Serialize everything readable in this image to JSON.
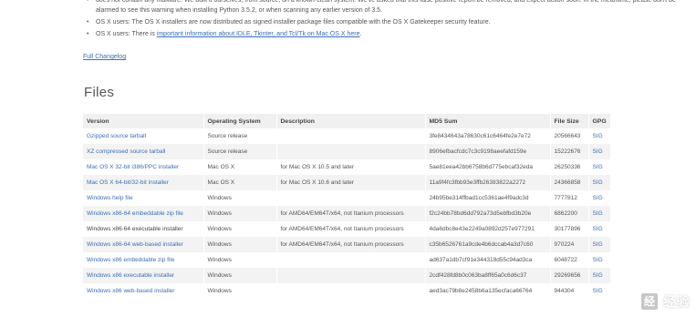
{
  "notes": [
    {
      "text_a": "does not contain any malware. We built it ourselves, from source, on a known-clean system. We've asked that this false positive report be removed, and expect action soon. In the meantime, please don't be alarmed to see this warning when installing Python 3.5.2, or when scanning any earlier version of 3.5.",
      "link": "",
      "text_b": ""
    },
    {
      "text_a": "OS X users: The OS X installers are now distributed as signed installer package files compatible with the OS X Gatekeeper security feature.",
      "link": "",
      "text_b": ""
    },
    {
      "text_a": "OS X users: There is ",
      "link": "important information about IDLE, Tkinter, and Tcl/Tk on Mac OS X here",
      "text_b": "."
    }
  ],
  "bullet_glyph": "•",
  "full_changelog": "Full Changelog",
  "files_title": "Files",
  "table": {
    "headers": [
      "Version",
      "Operating System",
      "Description",
      "MD5 Sum",
      "File Size",
      "GPG"
    ],
    "rows": [
      [
        "Gzipped source tarball",
        "Source release",
        "",
        "3fe8434643a78630c61c6464fe2e7e72",
        "20566643",
        "SIG"
      ],
      [
        "XZ compressed source tarball",
        "Source release",
        "",
        "8906efbacfcdc7c3c9198aeefafd159e",
        "15222676",
        "SIG"
      ],
      [
        "Mac OS X 32-bit i386/PPC installer",
        "Mac OS X",
        "for Mac OS X 10.5 and later",
        "5ae81eea42bb6758b6d775ebcaf32eda",
        "26250336",
        "SIG"
      ],
      [
        "Mac OS X 64-bit/32-bit installer",
        "Mac OS X",
        "for Mac OS X 10.6 and later",
        "11a9f4fc3fbb93e3ffb26383822a2272",
        "24366858",
        "SIG"
      ],
      [
        "Windows help file",
        "Windows",
        "",
        "24b95be314ffbad1cc5361ae4f9adc3d",
        "7777812",
        "SIG"
      ],
      [
        "Windows x86-64 embeddable zip file",
        "Windows",
        "for AMD64/EM64T/x64, not Itanium processors",
        "f2c24bb78bd6dd792a73d5ebfbd3b20e",
        "6862200",
        "SIG"
      ],
      [
        "Windows x86-64 executable installer",
        "Windows",
        "for AMD64/EM64T/x64, not Itanium processors",
        "4da6dbc8e43e2249a0892d257e977291",
        "30177896",
        "SIG"
      ],
      [
        "Windows x86-64 web-based installer",
        "Windows",
        "for AMD64/EM64T/x64, not Itanium processors",
        "c35b6526761a9cde4b6dccab4a3d7c60",
        "970224",
        "SIG"
      ],
      [
        "Windows x86 embeddable zip file",
        "Windows",
        "",
        "ad637a1db7cf91e344318d55c94ad3ca",
        "6048722",
        "SIG"
      ],
      [
        "Windows x86 executable installer",
        "Windows",
        "",
        "2cdf428fd8b0c063ba8ff65a0c6d6c37",
        "29269656",
        "SIG"
      ],
      [
        "Windows x86 web-based installer",
        "Windows",
        "",
        "aed3ac79b8e2458b6a135ecfaca66764",
        "944304",
        "SIG"
      ]
    ],
    "highlight_row": 6
  },
  "watermark": {
    "icon": "经",
    "text": "经验"
  }
}
